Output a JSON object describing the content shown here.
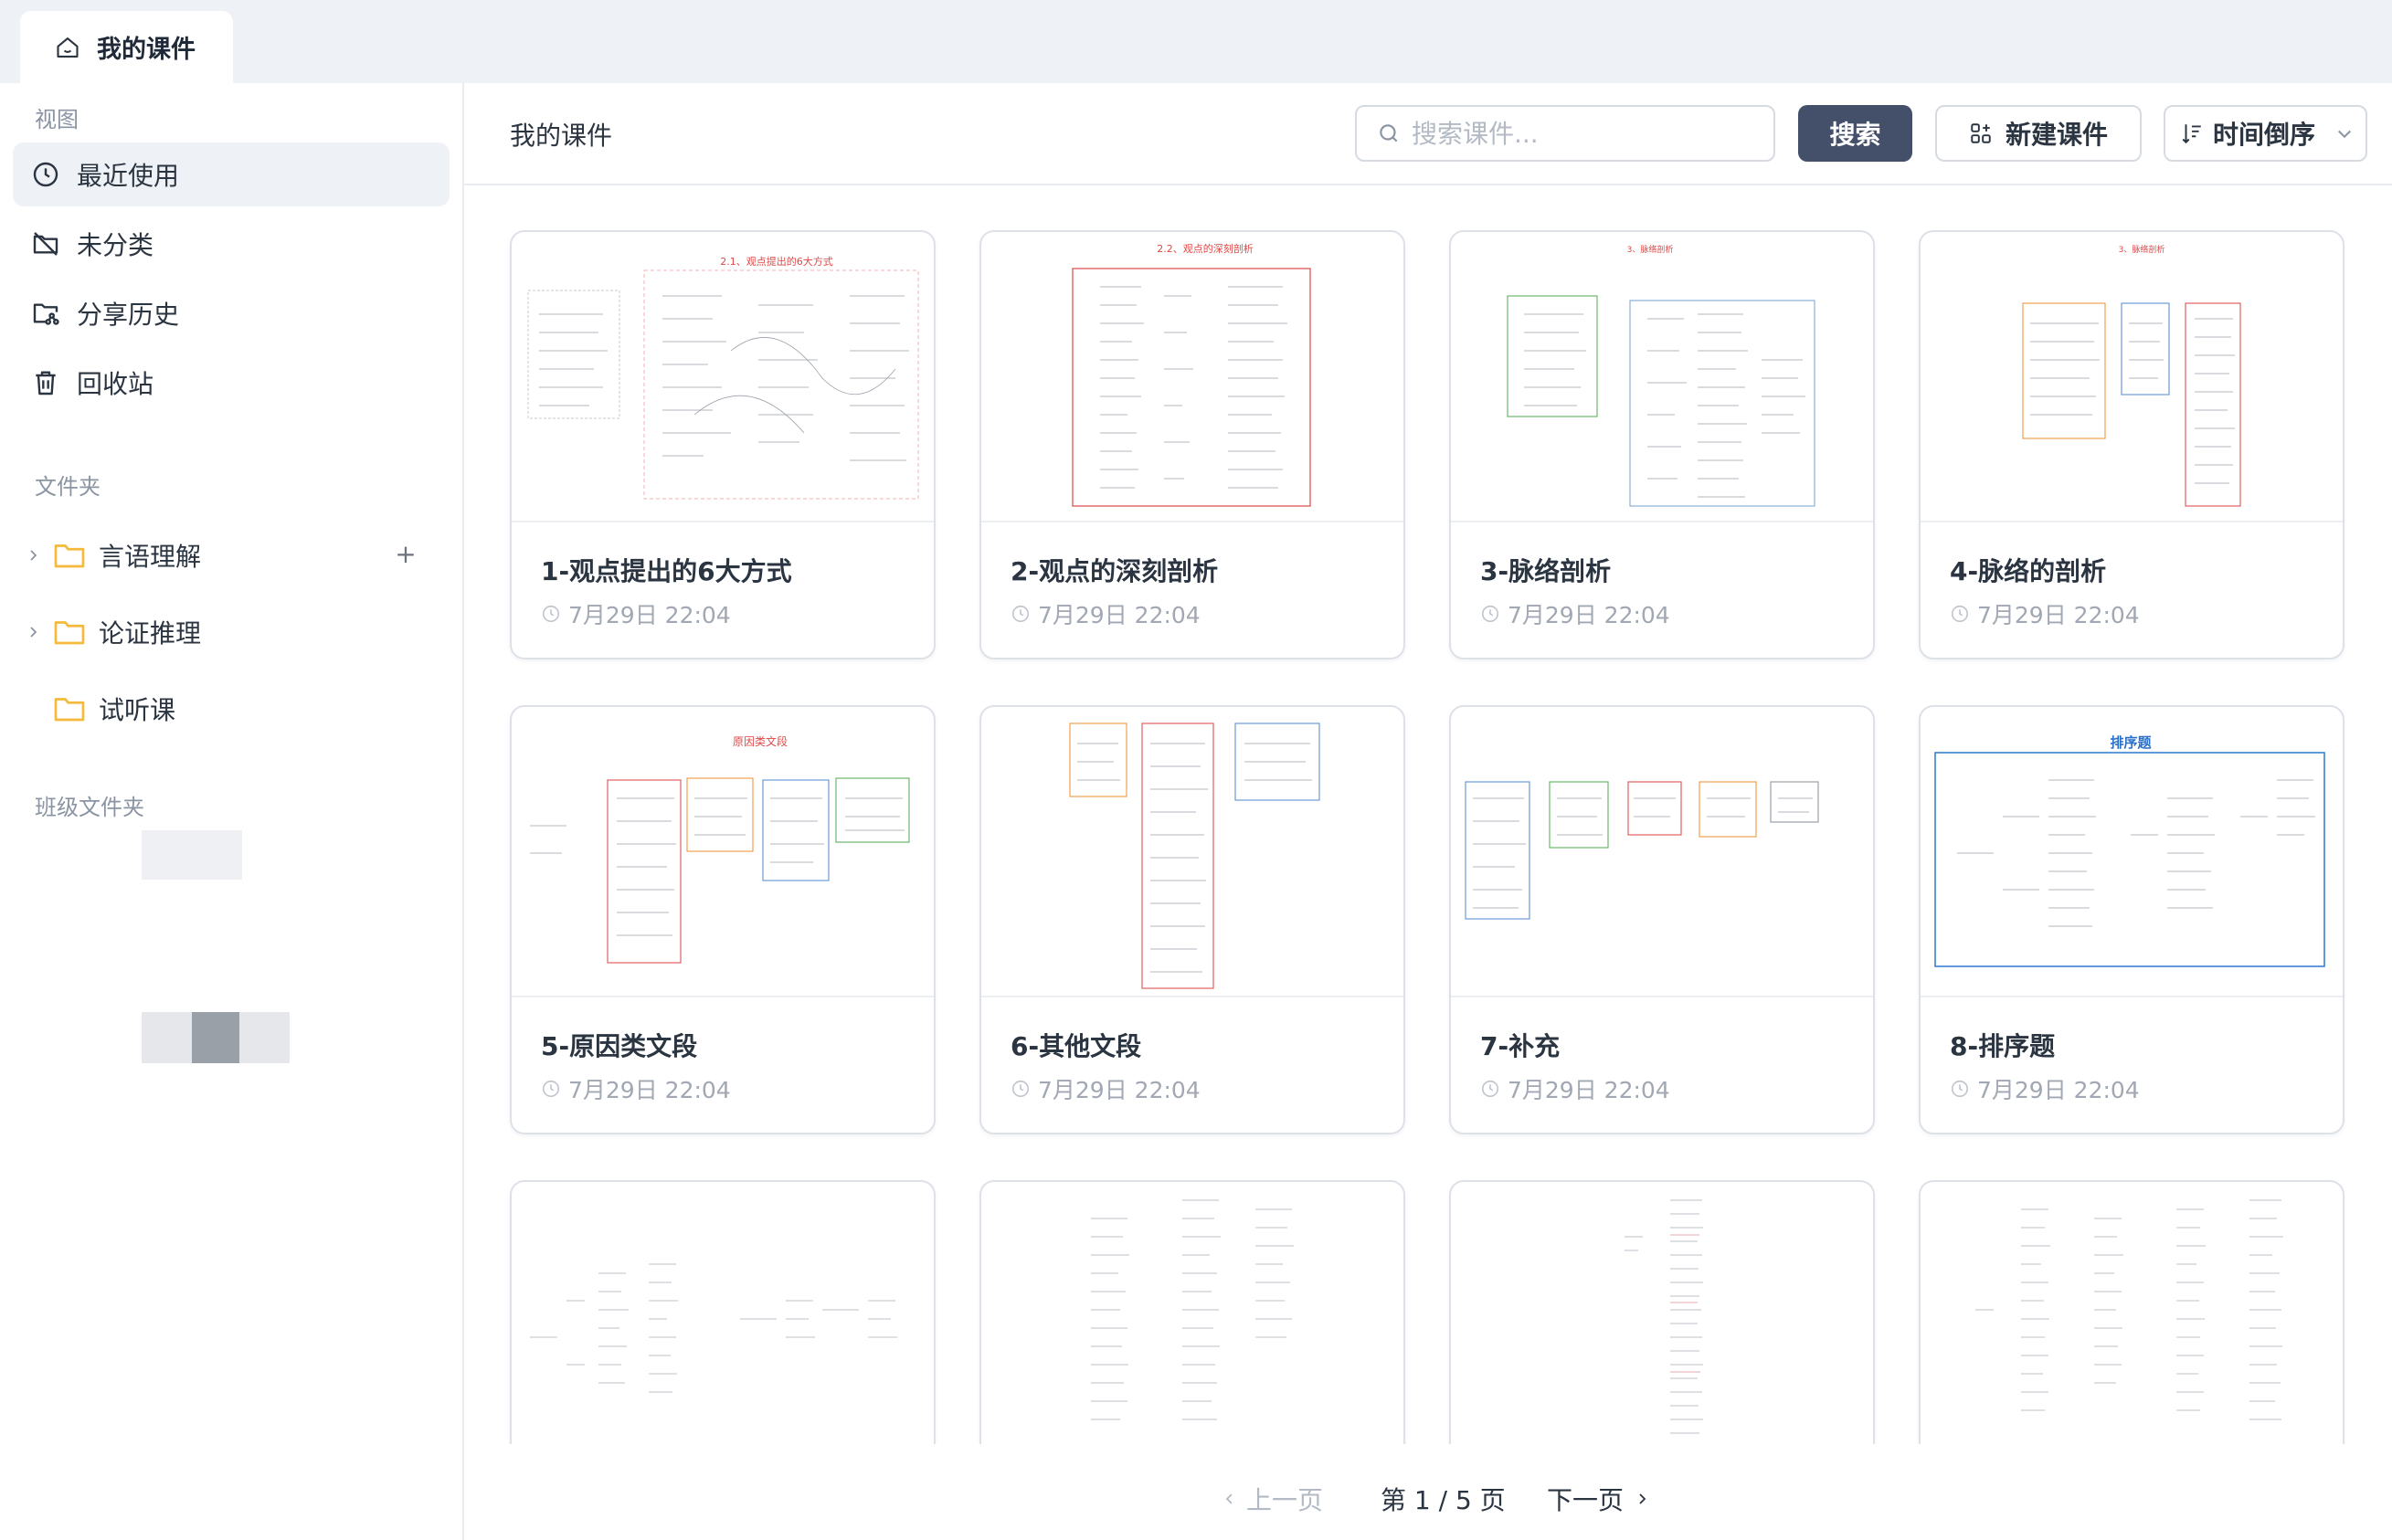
{
  "tab": {
    "label": "我的课件"
  },
  "sidebar": {
    "view_section": "视图",
    "items": [
      {
        "label": "最近使用",
        "icon": "clock-icon",
        "active": true
      },
      {
        "label": "未分类",
        "icon": "folder-off-icon"
      },
      {
        "label": "分享历史",
        "icon": "folder-share-icon"
      },
      {
        "label": "回收站",
        "icon": "trash-icon"
      }
    ],
    "folder_section": "文件夹",
    "folders": [
      {
        "label": "言语理解",
        "expandable": true
      },
      {
        "label": "论证推理",
        "expandable": true
      },
      {
        "label": "试听课",
        "expandable": false
      }
    ],
    "class_section": "班级文件夹"
  },
  "toolbar": {
    "title": "我的课件",
    "search_placeholder": "搜索课件...",
    "search_label": "搜索",
    "new_label": "新建课件",
    "sort_label": "时间倒序"
  },
  "cards": [
    {
      "title": "1-观点提出的6大方式",
      "time": "7月29日 22:04",
      "thumb_heading": "2.1、观点提出的6大方式"
    },
    {
      "title": "2-观点的深刻剖析",
      "time": "7月29日 22:04",
      "thumb_heading": "2.2、观点的深刻剖析"
    },
    {
      "title": "3-脉络剖析",
      "time": "7月29日 22:04",
      "thumb_heading": "3、脉络剖析"
    },
    {
      "title": "4-脉络的剖析",
      "time": "7月29日 22:04",
      "thumb_heading": "3、脉络剖析"
    },
    {
      "title": "5-原因类文段",
      "time": "7月29日 22:04",
      "thumb_heading": "原因类文段"
    },
    {
      "title": "6-其他文段",
      "time": "7月29日 22:04",
      "thumb_heading": ""
    },
    {
      "title": "7-补充",
      "time": "7月29日 22:04",
      "thumb_heading": ""
    },
    {
      "title": "8-排序题",
      "time": "7月29日 22:04",
      "thumb_heading": "排序题"
    },
    {
      "title": "",
      "time": "",
      "thumb_heading": ""
    },
    {
      "title": "",
      "time": "",
      "thumb_heading": ""
    },
    {
      "title": "",
      "time": "",
      "thumb_heading": ""
    },
    {
      "title": "",
      "time": "",
      "thumb_heading": ""
    }
  ],
  "pagination": {
    "prev_label": "上一页",
    "page_info": "第 1 / 5 页",
    "next_label": "下一页"
  },
  "colors": {
    "accent": "#44506a",
    "active_bg": "#eef1f5",
    "folder": "#f5b93b"
  }
}
